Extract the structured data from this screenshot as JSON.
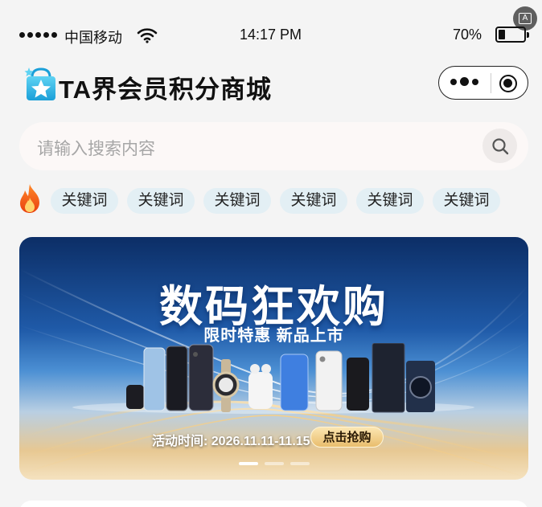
{
  "status_bar": {
    "carrier": "中国移动",
    "time": "14:17 PM",
    "battery": "70%",
    "battery_level": 0.7
  },
  "header": {
    "title": "TA界会员积分商城"
  },
  "search": {
    "placeholder": "请输入搜索内容"
  },
  "hot_keywords": [
    "关键词",
    "关键词",
    "关键词",
    "关键词",
    "关键词",
    "关键词"
  ],
  "banner": {
    "title": "数码狂欢购",
    "subtitle": "限时特惠  新品上市",
    "event_time": "活动时间: 2026.11.11-11.15",
    "cta": "点击抢购",
    "page_count": 3,
    "active_page": 1
  },
  "colors": {
    "page_bg": "#f4f4f4",
    "chip_bg": "#e3eff4",
    "search_bg": "#fcf8f7",
    "banner_dark": "#0c2e66",
    "cta_gold": "#e9bd6d"
  },
  "icons": [
    "signal-dots-icon",
    "wifi-icon",
    "battery-icon",
    "logo-star-bag-icon",
    "more-dots-icon",
    "close-target-icon",
    "search-icon",
    "fire-icon",
    "accessibility-icon"
  ]
}
